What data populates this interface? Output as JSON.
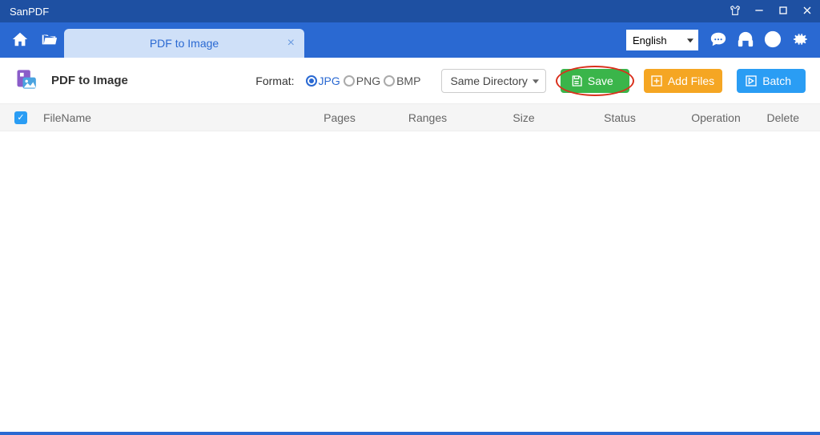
{
  "app": {
    "title": "SanPDF"
  },
  "tab": {
    "label": "PDF to Image"
  },
  "language": {
    "selected": "English"
  },
  "page": {
    "title": "PDF to Image",
    "format_label": "Format:",
    "formats": [
      {
        "label": "JPG",
        "selected": true
      },
      {
        "label": "PNG",
        "selected": false
      },
      {
        "label": "BMP",
        "selected": false
      }
    ],
    "directory": "Same Directory",
    "buttons": {
      "save": "Save",
      "add_files": "Add Files",
      "batch": "Batch"
    }
  },
  "table": {
    "headers": {
      "filename": "FileName",
      "pages": "Pages",
      "ranges": "Ranges",
      "size": "Size",
      "status": "Status",
      "operation": "Operation",
      "delete": "Delete"
    },
    "rows": []
  }
}
